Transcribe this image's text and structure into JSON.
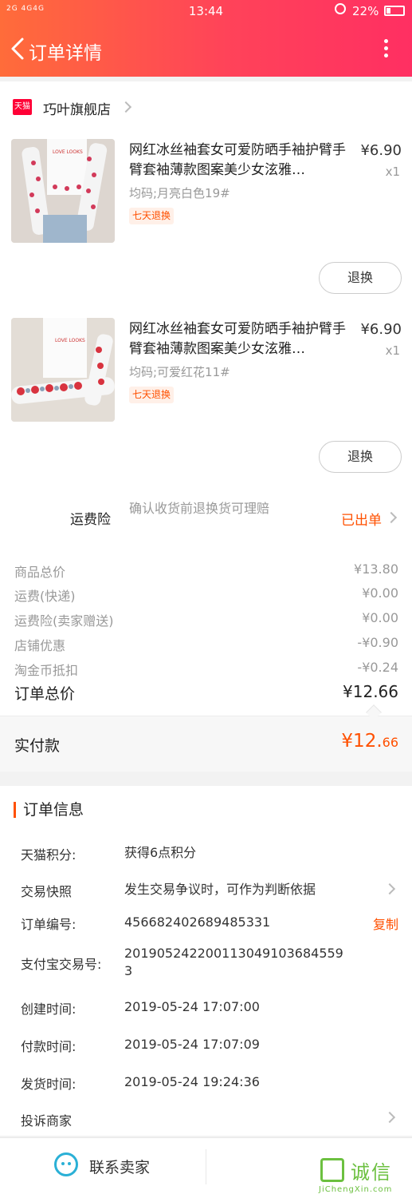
{
  "status_bar": {
    "signal": "2G 4G4G",
    "time": "13:44",
    "battery": "22%"
  },
  "navbar": {
    "title": "订单详情"
  },
  "shop": {
    "badge": "天猫",
    "name": "巧叶旗舰店"
  },
  "items": [
    {
      "title": "网红冰丝袖套女可爱防晒手袖护臂手臂套袖薄款图案美少女泫雅…",
      "price": "¥6.90",
      "qty": "x1",
      "sku": "均码;月亮白色19#",
      "tag": "七天退换",
      "action": "退换"
    },
    {
      "title": "网红冰丝袖套女可爱防晒手袖护臂手臂套袖薄款图案美少女泫雅…",
      "price": "¥6.90",
      "qty": "x1",
      "sku": "均码;可爱红花11#",
      "tag": "七天退换",
      "action": "退换"
    }
  ],
  "insurance": {
    "label": "运费险",
    "desc": "确认收货前退换货可理赔",
    "status": "已出单"
  },
  "fees": [
    {
      "label": "商品总价",
      "value": "¥13.80"
    },
    {
      "label": "运费(快递)",
      "value": "¥0.00"
    },
    {
      "label": "运费险(卖家赠送)",
      "value": "¥0.00"
    },
    {
      "label": "店铺优惠",
      "value": "-¥0.90"
    },
    {
      "label": "淘金币抵扣",
      "value": "-¥0.24"
    }
  ],
  "total": {
    "label": "订单总价",
    "value": "¥12.66"
  },
  "paid": {
    "label": "实付款",
    "value_main": "¥12.",
    "value_cents": "66"
  },
  "order_info": {
    "title": "订单信息",
    "rows": [
      {
        "label": "天猫积分:",
        "value": "获得6点积分"
      },
      {
        "label": "交易快照",
        "value": "发生交易争议时，可作为判断依据"
      },
      {
        "label": "订单编号:",
        "value": "456682402689485331"
      },
      {
        "label": "支付宝交易号:",
        "value": "2019052422001130491036845593"
      },
      {
        "label": "创建时间:",
        "value": "2019-05-24 17:07:00"
      },
      {
        "label": "付款时间:",
        "value": "2019-05-24 17:07:09"
      },
      {
        "label": "发货时间:",
        "value": "2019-05-24 19:24:36"
      },
      {
        "label": "投诉商家",
        "value": ""
      }
    ],
    "copy_label": "复制"
  },
  "bottom": {
    "contact_label": "联系卖家"
  },
  "watermark": {
    "chars": "诚信",
    "url": "JiChengXin.com"
  },
  "colors": {
    "header_start": "#ff6c3a",
    "header_end": "#ff2f62",
    "accent": "#ff5000",
    "tmall_red": "#ff0036"
  }
}
